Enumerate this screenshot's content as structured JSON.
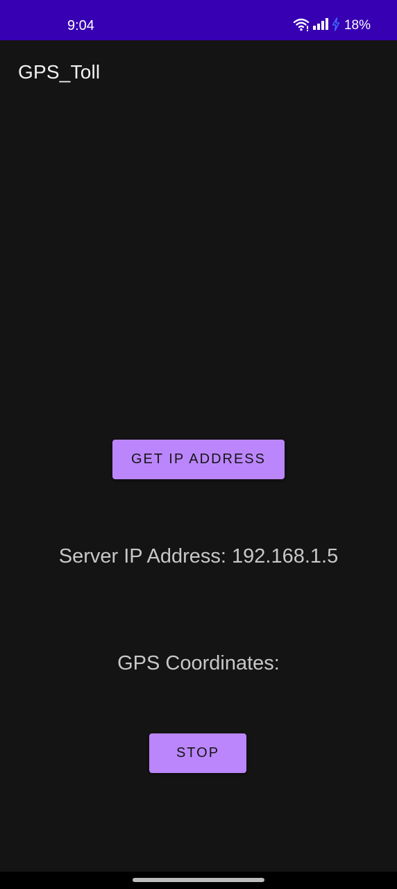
{
  "status_bar": {
    "time": "9:04",
    "battery_percent": "18%",
    "icons": [
      "wifi-icon",
      "signal-icon",
      "charging-bolt-icon"
    ],
    "background_color": "#3700b3"
  },
  "app_bar": {
    "title": "GPS_Toll"
  },
  "main": {
    "get_ip_button_label": "GET IP ADDRESS",
    "server_ip_text": "Server IP Address: 192.168.1.5",
    "gps_coordinates_text": "GPS Coordinates:",
    "stop_button_label": "STOP"
  },
  "colors": {
    "background": "#141414",
    "button": "#bb86fc",
    "text": "#c8c8c8",
    "charging_bolt": "#3b6cff"
  }
}
